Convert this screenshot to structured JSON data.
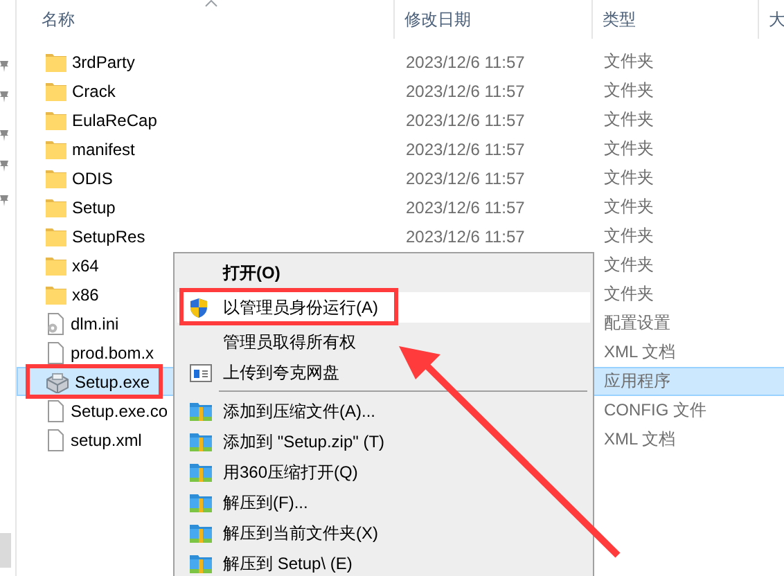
{
  "columns": [
    {
      "label": "名称",
      "sorted": true
    },
    {
      "label": "修改日期",
      "sorted": false
    },
    {
      "label": "类型",
      "sorted": false
    },
    {
      "label": "大",
      "sorted": false
    }
  ],
  "files": [
    {
      "name": "3rdParty",
      "kind": "folder",
      "modified": "2023/12/6 11:57",
      "type": "文件夹",
      "selected": false
    },
    {
      "name": "Crack",
      "kind": "folder",
      "modified": "2023/12/6 11:57",
      "type": "文件夹",
      "selected": false
    },
    {
      "name": "EulaReCap",
      "kind": "folder",
      "modified": "2023/12/6 11:57",
      "type": "文件夹",
      "selected": false
    },
    {
      "name": "manifest",
      "kind": "folder",
      "modified": "2023/12/6 11:57",
      "type": "文件夹",
      "selected": false
    },
    {
      "name": "ODIS",
      "kind": "folder",
      "modified": "2023/12/6 11:57",
      "type": "文件夹",
      "selected": false
    },
    {
      "name": "Setup",
      "kind": "folder",
      "modified": "2023/12/6 11:57",
      "type": "文件夹",
      "selected": false
    },
    {
      "name": "SetupRes",
      "kind": "folder",
      "modified": "2023/12/6 11:57",
      "type": "文件夹",
      "selected": false
    },
    {
      "name": "x64",
      "kind": "folder",
      "type": "文件夹",
      "selected": false
    },
    {
      "name": "x86",
      "kind": "folder",
      "type": "文件夹",
      "selected": false
    },
    {
      "name": "dlm.ini",
      "kind": "settings",
      "type": "配置设置",
      "selected": false
    },
    {
      "name": "prod.bom.x",
      "kind": "document",
      "type": "XML 文档",
      "selected": false
    },
    {
      "name": "Setup.exe",
      "kind": "installer",
      "type": "应用程序",
      "selected": true
    },
    {
      "name": "Setup.exe.co",
      "kind": "document",
      "type": "CONFIG 文件",
      "selected": false
    },
    {
      "name": "setup.xml",
      "kind": "document",
      "type": "XML 文档",
      "selected": false
    }
  ],
  "context_menu": {
    "groups": [
      [
        {
          "label": "打开(O)",
          "kind": "plain",
          "default": true,
          "highlighted": false
        },
        {
          "label": "以管理员身份运行(A)",
          "kind": "shield",
          "default": false,
          "highlighted": true
        },
        {
          "label": "管理员取得所有权",
          "kind": "plain",
          "default": false,
          "highlighted": false
        },
        {
          "label": "上传到夸克网盘",
          "kind": "panel",
          "default": false,
          "highlighted": false
        }
      ],
      [
        {
          "label": "添加到压缩文件(A)...",
          "kind": "archive",
          "default": false,
          "highlighted": false
        },
        {
          "label": "添加到 \"Setup.zip\" (T)",
          "kind": "archive",
          "default": false,
          "highlighted": false
        },
        {
          "label": "用360压缩打开(Q)",
          "kind": "archive",
          "default": false,
          "highlighted": false
        },
        {
          "label": "解压到(F)...",
          "kind": "archive",
          "default": false,
          "highlighted": false
        },
        {
          "label": "解压到当前文件夹(X)",
          "kind": "archive",
          "default": false,
          "highlighted": false
        },
        {
          "label": "解压到 Setup\\ (E)",
          "kind": "archive",
          "default": false,
          "highlighted": false
        }
      ]
    ]
  }
}
